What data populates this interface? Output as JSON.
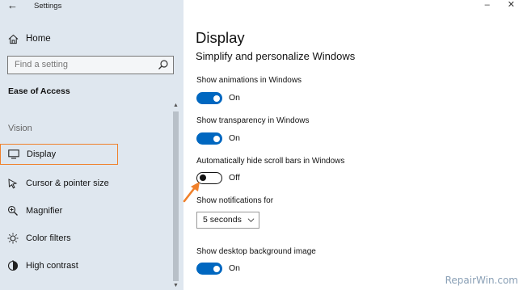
{
  "window": {
    "title": "Settings",
    "back_icon": "back-arrow-icon",
    "controls": [
      "minimize",
      "close"
    ]
  },
  "sidebar": {
    "home_label": "Home",
    "search_placeholder": "Find a setting",
    "section_heading": "Ease of Access",
    "group_label": "Vision",
    "items": [
      {
        "label": "Display",
        "icon": "monitor-icon",
        "selected": true
      },
      {
        "label": "Cursor & pointer size",
        "icon": "cursor-icon",
        "selected": false
      },
      {
        "label": "Magnifier",
        "icon": "magnifier-icon",
        "selected": false
      },
      {
        "label": "Color filters",
        "icon": "color-filter-icon",
        "selected": false
      },
      {
        "label": "High contrast",
        "icon": "high-contrast-icon",
        "selected": false
      }
    ]
  },
  "main": {
    "title": "Display",
    "subtitle": "Simplify and personalize Windows",
    "settings": [
      {
        "label": "Show animations in Windows",
        "state": "On"
      },
      {
        "label": "Show transparency in Windows",
        "state": "On"
      },
      {
        "label": "Automatically hide scroll bars in Windows",
        "state": "Off"
      },
      {
        "label": "Show notifications for",
        "dropdown_value": "5 seconds"
      },
      {
        "label": "Show desktop background image",
        "state": "On"
      }
    ]
  },
  "colors": {
    "accent": "#0067c0",
    "annotation": "#f0802a",
    "sidebar_bg": "#dfe7ef"
  },
  "watermark": "RepairWin.com"
}
